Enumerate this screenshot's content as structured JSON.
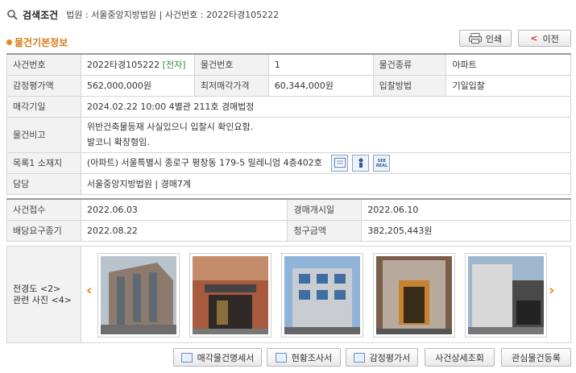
{
  "search": {
    "title": "검색조건",
    "conditions": "법원 : 서울중앙지방법원  |  사건번호 : 2022타경105222"
  },
  "section": {
    "title": "물건기본정보"
  },
  "toolbar": {
    "print_label": "인쇄",
    "prev_label": "이전"
  },
  "basic": {
    "case_no_label": "사건번호",
    "case_no": "2022타경105222",
    "electronic_tag": "[전자]",
    "item_no_label": "물건번호",
    "item_no": "1",
    "item_type_label": "물건종류",
    "item_type": "아파트",
    "appraisal_label": "감정평가액",
    "appraisal": "562,000,000원",
    "min_price_label": "최저매각가격",
    "min_price": "60,344,000원",
    "bid_method_label": "입찰방법",
    "bid_method": "기일입찰",
    "sale_date_label": "매각기일",
    "sale_date": "2024.02.22 10:00 4별관 211호 경매법정",
    "remarks_label": "물건비고",
    "remarks_line1": "위반건축물등재 사실있으니 입찰시 확인요함.",
    "remarks_line2": "발코니 확장형임.",
    "address_label": "목록1 소재지",
    "address": "(아파트) 서울특별시 종로구 평창동 179-5 밀레니엄 4층402호",
    "contact_label": "담당",
    "contact": "서울중앙지방법원 | 경매7계"
  },
  "dates": {
    "received_label": "사건접수",
    "received": "2022.06.03",
    "auction_start_label": "경매개시일",
    "auction_start": "2022.06.10",
    "claim_deadline_label": "배당요구종기",
    "claim_deadline": "2022.08.22",
    "claim_amount_label": "청구금액",
    "claim_amount": "382,205,443원"
  },
  "photos": {
    "label_line1": "전경도 <2>",
    "label_line2": "관련 사진 <4>",
    "count_shown": 5
  },
  "bottom": {
    "sale_doc": "매각물건명세서",
    "status_report": "현황조사서",
    "appraisal_doc": "감정평가서",
    "case_detail": "사건상세조회",
    "watch": "관심물건등록"
  },
  "colors": {
    "accent": "#e8861a",
    "electronic": "#2b8b3c",
    "header_bg": "#f2f2f2"
  },
  "icons": [
    "search-icon",
    "printer-icon",
    "chevron-left-icon",
    "map-icon",
    "street-view-icon",
    "seereal-icon",
    "chevron-right-icon",
    "document-icon"
  ]
}
